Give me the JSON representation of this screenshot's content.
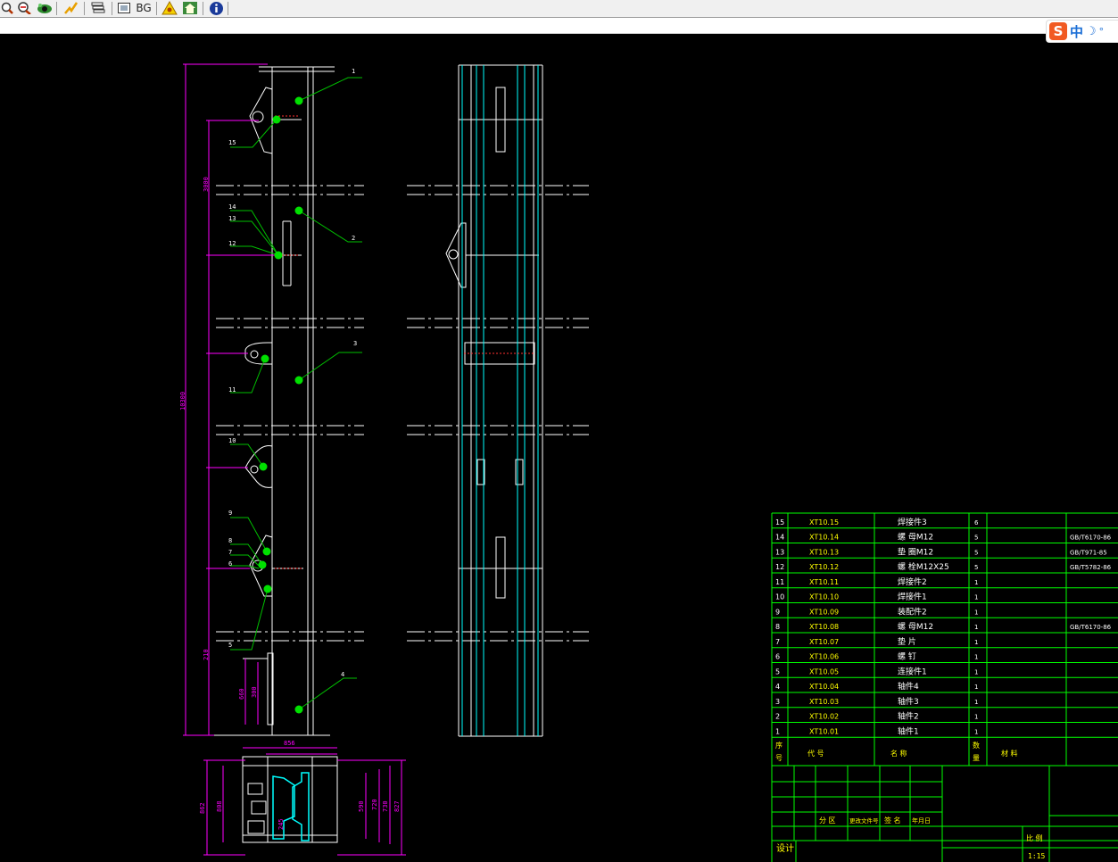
{
  "toolbar": {
    "bg_label": "BG",
    "buttons": [
      "zoom-in",
      "zoom-out",
      "eye",
      "pan",
      "layers",
      "background",
      "bg",
      "fit",
      "home",
      "info"
    ]
  },
  "ime": {
    "logo": "S",
    "lang": "中"
  },
  "drawing": {
    "balloons_left": [
      "1",
      "15",
      "14",
      "13",
      "12",
      "2",
      "3",
      "11",
      "10",
      "9",
      "8",
      "7",
      "6",
      "5",
      "4"
    ],
    "dims_left": [
      "3000",
      "10300",
      "660",
      "300",
      "210"
    ],
    "dims_bottom": {
      "top": "856",
      "left_a": "862",
      "left_b": "808",
      "right_a": "590",
      "right_b": "720",
      "right_c": "730",
      "right_d": "827",
      "inner": "245"
    }
  },
  "bom": {
    "rows": [
      {
        "no": "15",
        "code": "XT10.15",
        "name": "焊接件3",
        "qty": "6",
        "std": ""
      },
      {
        "no": "14",
        "code": "XT10.14",
        "name": "螺 母M12",
        "qty": "5",
        "std": "GB/T6170-86"
      },
      {
        "no": "13",
        "code": "XT10.13",
        "name": "垫 圈M12",
        "qty": "5",
        "std": "GB/T971-85"
      },
      {
        "no": "12",
        "code": "XT10.12",
        "name": "螺 栓M12X25",
        "qty": "5",
        "std": "GB/T5782-86"
      },
      {
        "no": "11",
        "code": "XT10.11",
        "name": "焊接件2",
        "qty": "1",
        "std": ""
      },
      {
        "no": "10",
        "code": "XT10.10",
        "name": "焊接件1",
        "qty": "1",
        "std": ""
      },
      {
        "no": "9",
        "code": "XT10.09",
        "name": "装配件2",
        "qty": "1",
        "std": ""
      },
      {
        "no": "8",
        "code": "XT10.08",
        "name": "螺 母M12",
        "qty": "1",
        "std": "GB/T6170-86"
      },
      {
        "no": "7",
        "code": "XT10.07",
        "name": "垫 片",
        "qty": "1",
        "std": ""
      },
      {
        "no": "6",
        "code": "XT10.06",
        "name": "螺 钉",
        "qty": "1",
        "std": ""
      },
      {
        "no": "5",
        "code": "XT10.05",
        "name": "连接件1",
        "qty": "1",
        "std": ""
      },
      {
        "no": "4",
        "code": "XT10.04",
        "name": "轴件4",
        "qty": "1",
        "std": ""
      },
      {
        "no": "3",
        "code": "XT10.03",
        "name": "轴件3",
        "qty": "1",
        "std": ""
      },
      {
        "no": "2",
        "code": "XT10.02",
        "name": "轴件2",
        "qty": "1",
        "std": ""
      },
      {
        "no": "1",
        "code": "XT10.01",
        "name": "轴件1",
        "qty": "1",
        "std": ""
      }
    ],
    "header": {
      "no_a": "序",
      "no_b": "号",
      "code": "代    号",
      "name": "名    称",
      "qty_a": "数",
      "qty_b": "量",
      "material": "材  料"
    },
    "title_block": {
      "l1": "分  区",
      "l2": "更改文件号",
      "l3": "签  名",
      "l4": "年月日",
      "design": "设计",
      "scale_label": "比 例",
      "scale": "1:15"
    }
  },
  "colors": {
    "outline": "#ffffff",
    "dims": "#ff00ff",
    "leaders": "#00ff00",
    "balloon": "#00e000",
    "cyan": "#00ffff",
    "table": "#00ff00",
    "text": "#ffff00"
  }
}
